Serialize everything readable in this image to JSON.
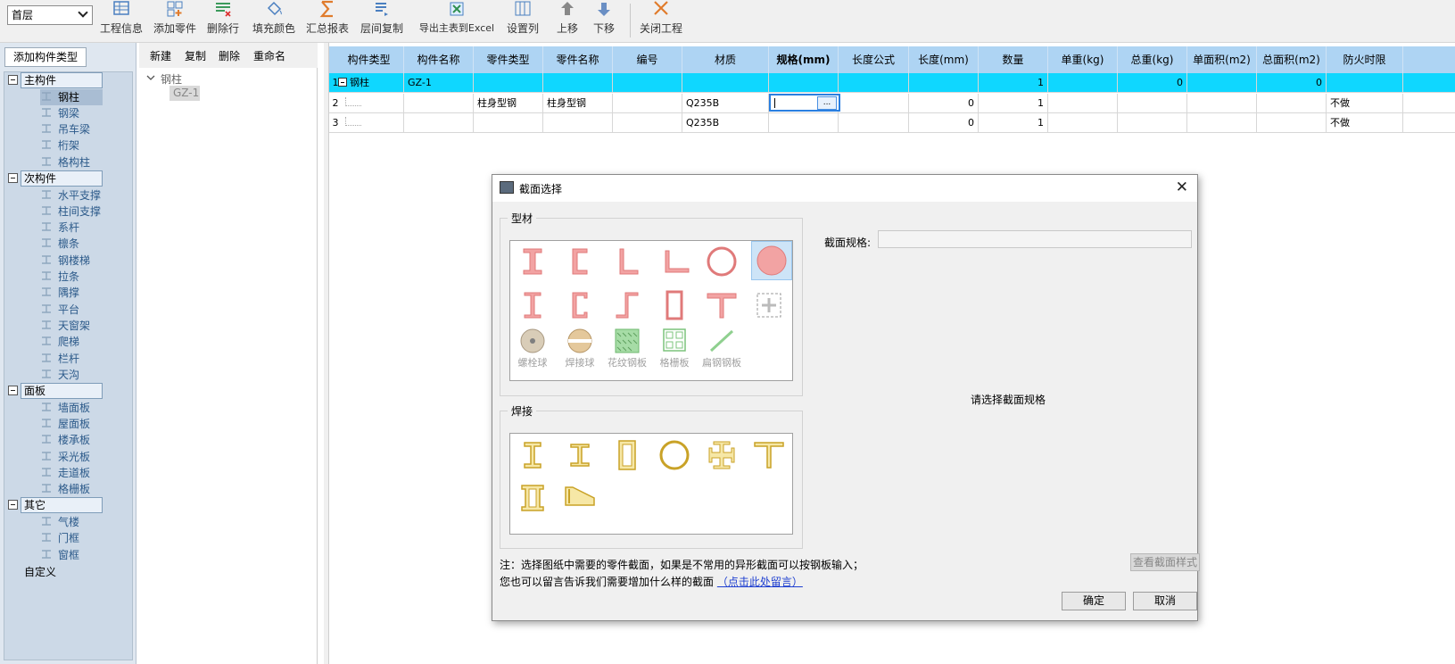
{
  "floor": {
    "value": "首层"
  },
  "toolbar": [
    {
      "id": "info",
      "label": "工程信息"
    },
    {
      "id": "add",
      "label": "添加零件"
    },
    {
      "id": "delrow",
      "label": "删除行"
    },
    {
      "id": "fill",
      "label": "填充颜色"
    },
    {
      "id": "report",
      "label": "汇总报表"
    },
    {
      "id": "copy",
      "label": "层间复制"
    },
    {
      "id": "export",
      "label": "导出主表到Excel"
    },
    {
      "id": "cols",
      "label": "设置列"
    },
    {
      "id": "up",
      "label": "上移"
    },
    {
      "id": "down",
      "label": "下移"
    },
    {
      "id": "close",
      "label": "关闭工程"
    }
  ],
  "left": {
    "add_button": "添加构件类型",
    "groups": [
      {
        "label": "主构件",
        "items": [
          "钢柱",
          "钢梁",
          "吊车梁",
          "桁架",
          "格构柱"
        ]
      },
      {
        "label": "次构件",
        "items": [
          "水平支撑",
          "柱间支撑",
          "系杆",
          "檩条",
          "钢楼梯",
          "拉条",
          "隅撑",
          "平台",
          "天窗架",
          "爬梯",
          "栏杆",
          "天沟"
        ]
      },
      {
        "label": "面板",
        "items": [
          "墙面板",
          "屋面板",
          "楼承板",
          "采光板",
          "走道板",
          "格栅板"
        ]
      },
      {
        "label": "其它",
        "items": [
          "气楼",
          "门框",
          "窗框"
        ]
      }
    ],
    "custom": "自定义"
  },
  "mid": {
    "new": "新建",
    "copy": "复制",
    "delete": "删除",
    "rename": "重命名",
    "node": "钢柱",
    "leaf": "GZ-1"
  },
  "grid": {
    "headers": [
      "构件类型",
      "构件名称",
      "零件类型",
      "零件名称",
      "编号",
      "材质",
      "规格(mm)",
      "长度公式",
      "长度(mm)",
      "数量",
      "单重(kg)",
      "总重(kg)",
      "单面积(m2)",
      "总面积(m2)",
      "防火时限"
    ],
    "rows": [
      {
        "n": "1",
        "cells": [
          "钢柱",
          "GZ-1",
          "",
          "",
          "",
          "",
          "",
          "",
          "",
          "1",
          "",
          "0",
          "",
          "0",
          ""
        ]
      },
      {
        "n": "2",
        "cells": [
          "",
          "",
          "柱身型钢",
          "柱身型钢",
          "",
          "Q235B",
          "",
          "",
          "0",
          "1",
          "",
          "",
          "",
          "",
          "不做"
        ]
      },
      {
        "n": "3",
        "cells": [
          "",
          "",
          "",
          "",
          "",
          "Q235B",
          "",
          "",
          "0",
          "1",
          "",
          "",
          "",
          "",
          "不做"
        ]
      }
    ],
    "edit_button": "..."
  },
  "dialog": {
    "title": "截面选择",
    "section_profile": "型材",
    "section_weld": "焊接",
    "spec_label": "截面规格:",
    "hint": "请选择截面规格",
    "profile_labels": [
      "螺栓球",
      "焊接球",
      "花纹钢板",
      "格栅板",
      "扁钢钢板"
    ],
    "note1": "注：选择图纸中需要的零件截面，如果是不常用的异形截面可以按钢板输入；",
    "note2": "您也可以留言告诉我们需要增加什么样的截面",
    "link": "（点击此处留言）",
    "view_style": "查看截面样式",
    "ok": "确定",
    "cancel": "取消",
    "close": "✕"
  },
  "colors": {
    "accent": "#0fd7ff",
    "header": "#aed4f3",
    "shape_red": "#e07a7a",
    "shape_gold": "#c9a227"
  }
}
